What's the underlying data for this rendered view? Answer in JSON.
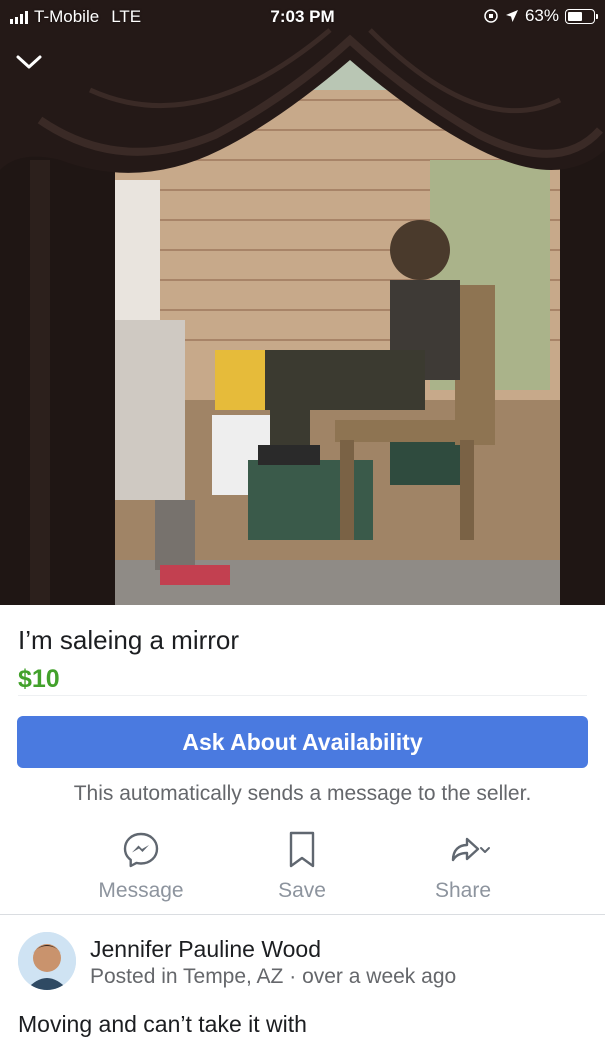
{
  "status_bar": {
    "carrier": "T-Mobile",
    "network": "LTE",
    "time": "7:03 PM",
    "battery": "63%",
    "battery_level": 0.63,
    "icons": [
      "signal-bars-icon",
      "orientation-lock-icon",
      "location-arrow-icon",
      "battery-icon"
    ]
  },
  "header": {
    "close_icon": "chevron-down-icon"
  },
  "listing": {
    "title": "I’m saleing a mirror",
    "price": "$10"
  },
  "cta": {
    "ask_label": "Ask About Availability",
    "note": "This automatically sends a message to the seller."
  },
  "actions": {
    "message_label": "Message",
    "save_label": "Save",
    "share_label": "Share",
    "message_icon": "messenger-icon",
    "save_icon": "bookmark-icon",
    "share_icon": "share-arrow-icon"
  },
  "seller": {
    "name": "Jennifer Pauline Wood",
    "posted_in": "Posted in Tempe, AZ",
    "separator": "·",
    "time_ago": "over a week ago"
  },
  "description": "Moving and can’t take it with",
  "colors": {
    "accent_blue": "#4a7ae0",
    "price_green": "#42a12b",
    "muted_text": "#65676b",
    "action_gray": "#8d949e"
  }
}
